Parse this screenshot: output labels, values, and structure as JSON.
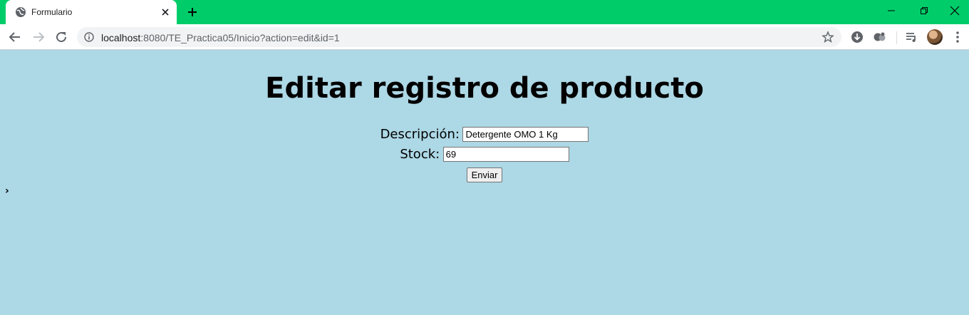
{
  "browser": {
    "tab": {
      "title": "Formulario"
    },
    "address_bar": {
      "host": "localhost",
      "rest": ":8080/TE_Practica05/Inicio?action=edit&id=1"
    },
    "theme_color": "#00cc6a"
  },
  "page": {
    "background": "#add8e6",
    "title": "Editar registro de producto",
    "form": {
      "description_label": "Descripción:",
      "description_value": "Detergente OMO 1 Kg",
      "stock_label": "Stock:",
      "stock_value": "69",
      "submit_label": "Enviar"
    },
    "caret": "›"
  },
  "icons": [
    "globe-icon",
    "close-icon",
    "plus-icon",
    "minimize-icon",
    "restore-icon",
    "window-close-icon",
    "back-arrow-icon",
    "forward-arrow-icon",
    "reload-icon",
    "info-icon",
    "star-icon",
    "download-icon",
    "extensions-icon",
    "media-queue-icon",
    "menu-dots-icon"
  ]
}
